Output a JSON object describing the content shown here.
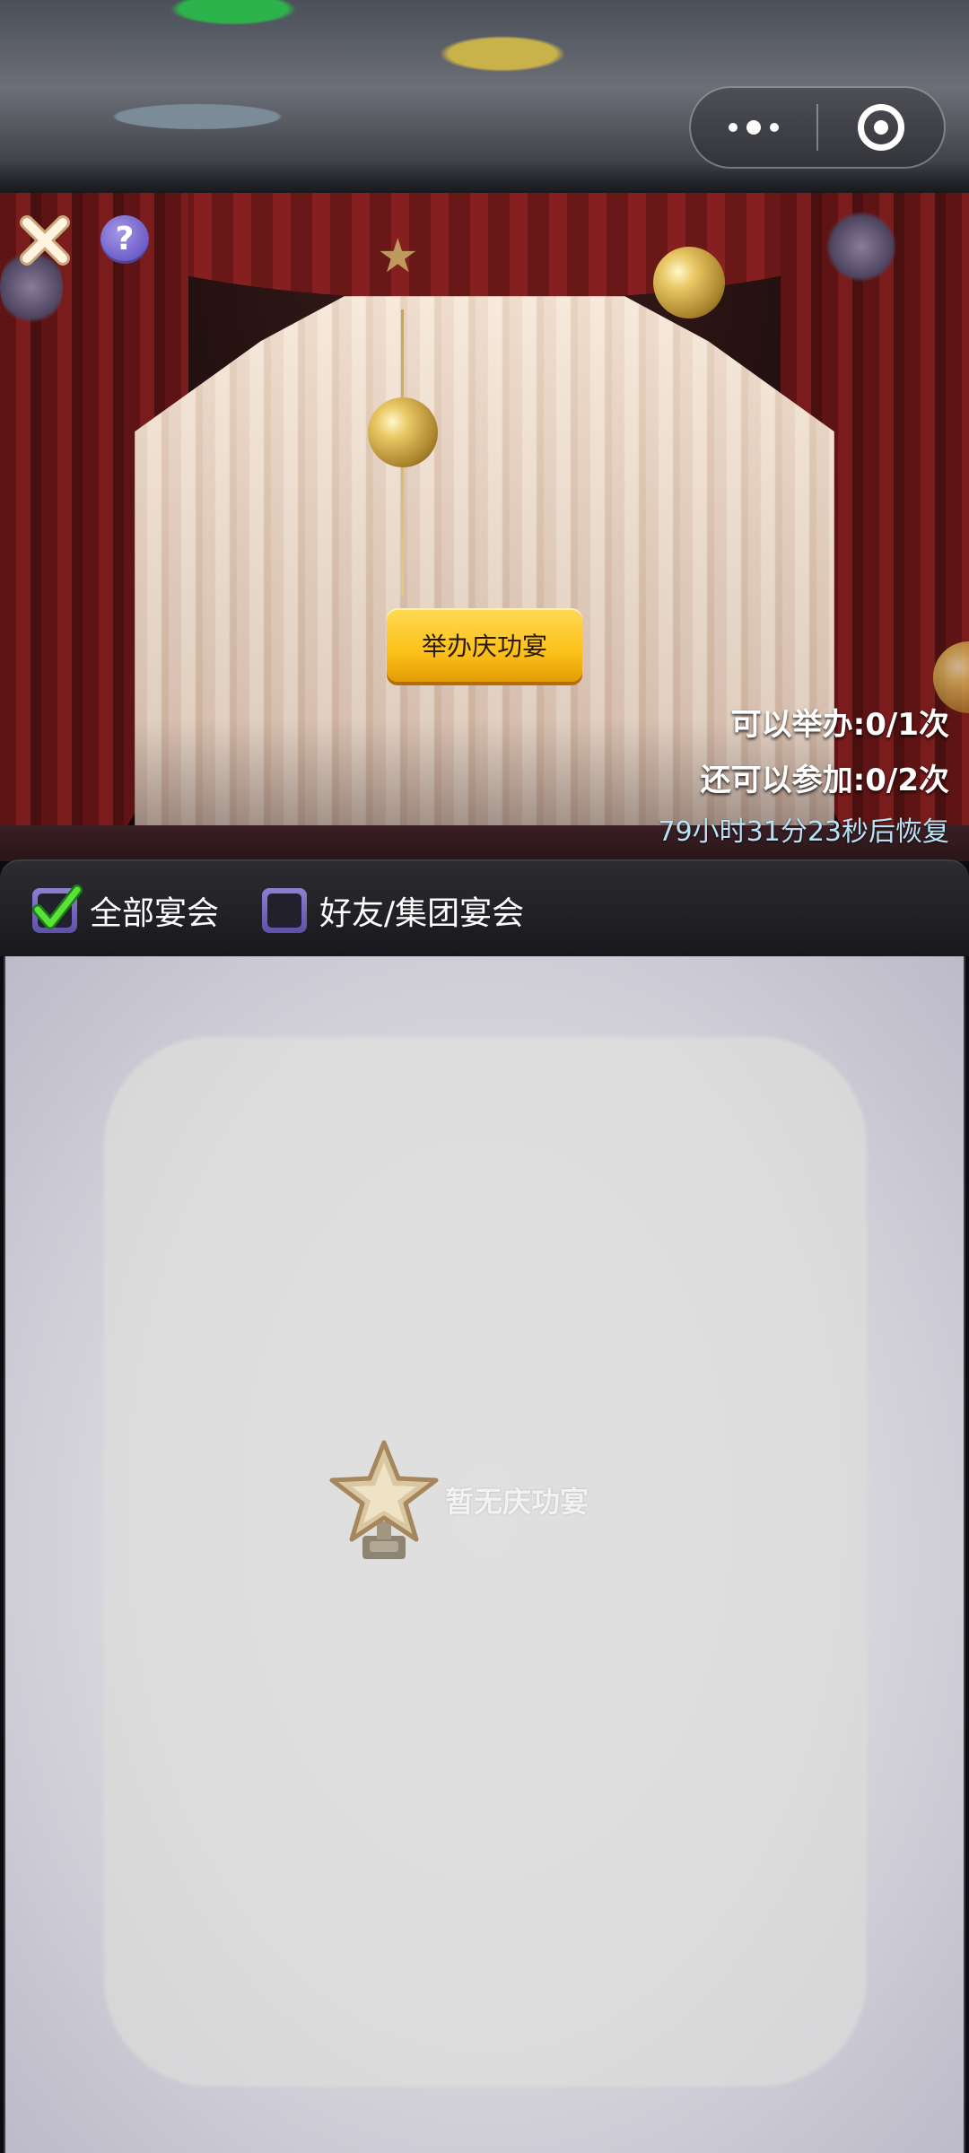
{
  "capsule": {
    "more_icon": "more-dots-icon",
    "close_icon": "target-circle-icon"
  },
  "panel": {
    "close_icon": "close-x-icon",
    "help": "?",
    "host_button": "举办庆功宴",
    "stats": {
      "can_host": "可以举办:0/1次",
      "can_join": "还可以参加:0/2次",
      "recover": "79小时31分23秒后恢复"
    }
  },
  "filters": {
    "all": {
      "label": "全部宴会",
      "checked": true
    },
    "friends": {
      "label": "好友/集团宴会",
      "checked": false
    }
  },
  "list": {
    "empty_text": "暂无庆功宴",
    "empty_icon": "star-trophy-icon"
  },
  "colors": {
    "accent_button": "#fcc11a",
    "checkbox": "#6a5cc7",
    "recover_text": "#b9e2f5"
  }
}
